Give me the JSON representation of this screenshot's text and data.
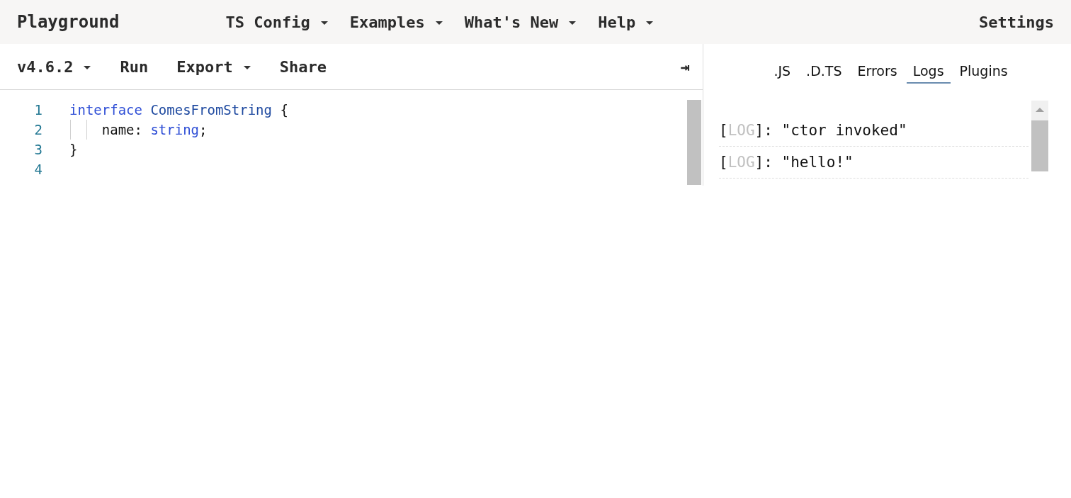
{
  "nav": {
    "brand": "Playground",
    "menus": [
      {
        "label": "TS Config",
        "dropdown": true
      },
      {
        "label": "Examples",
        "dropdown": true
      },
      {
        "label": "What's New",
        "dropdown": true
      },
      {
        "label": "Help",
        "dropdown": true
      }
    ],
    "settings": "Settings"
  },
  "toolbar": {
    "items": [
      {
        "label": "v4.6.2",
        "dropdown": true
      },
      {
        "label": "Run",
        "dropdown": false
      },
      {
        "label": "Export",
        "dropdown": true
      },
      {
        "label": "Share",
        "dropdown": false
      }
    ],
    "collapse": "⇥"
  },
  "editor": {
    "lines": [
      {
        "number": "1",
        "tokens": [
          {
            "kind": "keyword",
            "text": "interface "
          },
          {
            "kind": "type",
            "text": "ComesFromString"
          },
          {
            "kind": "plain",
            "text": " {"
          }
        ]
      },
      {
        "number": "2",
        "tokens": [
          {
            "kind": "plain",
            "text": "    name: "
          },
          {
            "kind": "keyword",
            "text": "string"
          },
          {
            "kind": "plain",
            "text": ";"
          }
        ]
      },
      {
        "number": "3",
        "tokens": [
          {
            "kind": "plain",
            "text": "}"
          }
        ]
      },
      {
        "number": "4"
      }
    ]
  },
  "sidebar": {
    "tabs": [
      {
        "label": ".JS",
        "selected": false
      },
      {
        "label": ".D.TS",
        "selected": false
      },
      {
        "label": "Errors",
        "selected": false
      },
      {
        "label": "Logs",
        "selected": true
      },
      {
        "label": "Plugins",
        "selected": false
      }
    ],
    "logs": [
      {
        "open": "[",
        "tag": "LOG",
        "rest": "]: \"ctor invoked\""
      },
      {
        "open": "[",
        "tag": "LOG",
        "rest": "]: \"hello!\""
      }
    ]
  }
}
